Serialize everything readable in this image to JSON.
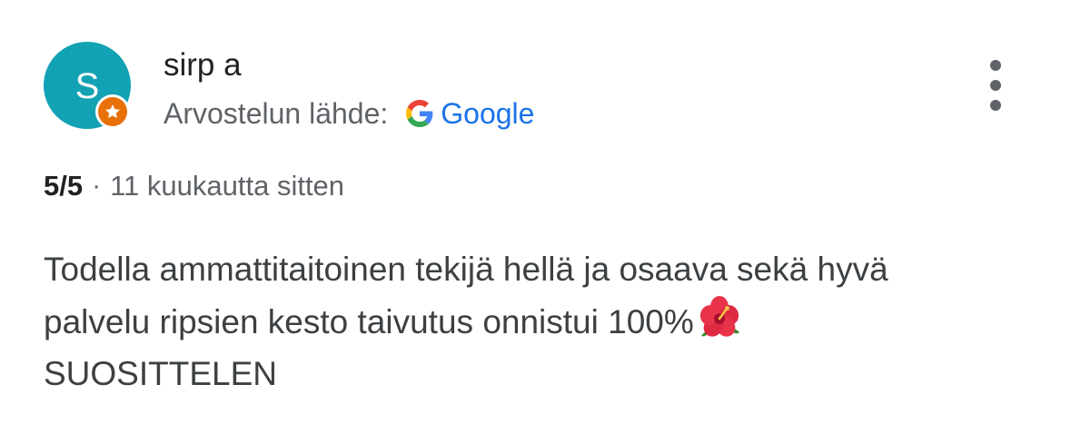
{
  "review": {
    "author": {
      "initial": "S",
      "name": "sirp a",
      "avatar_color": "#12a2b3",
      "badge": "local-guide-star-icon",
      "badge_color": "#e8710a"
    },
    "source": {
      "label": "Arvostelun lähde:",
      "provider": "Google",
      "provider_icon": "google-g-icon",
      "provider_color": "#1a73e8"
    },
    "rating": "5/5",
    "separator": "·",
    "time_ago": "11 kuukautta sitten",
    "text_lines": [
      "Todella ammattitaitoinen tekijä hellä ja osaava sekä hyvä",
      "palvelu ripsien kesto taivutus onnistui 100%",
      "SUOSITTELEN"
    ],
    "emoji": "hibiscus-emoji",
    "more_icon": "more-vert-icon"
  }
}
